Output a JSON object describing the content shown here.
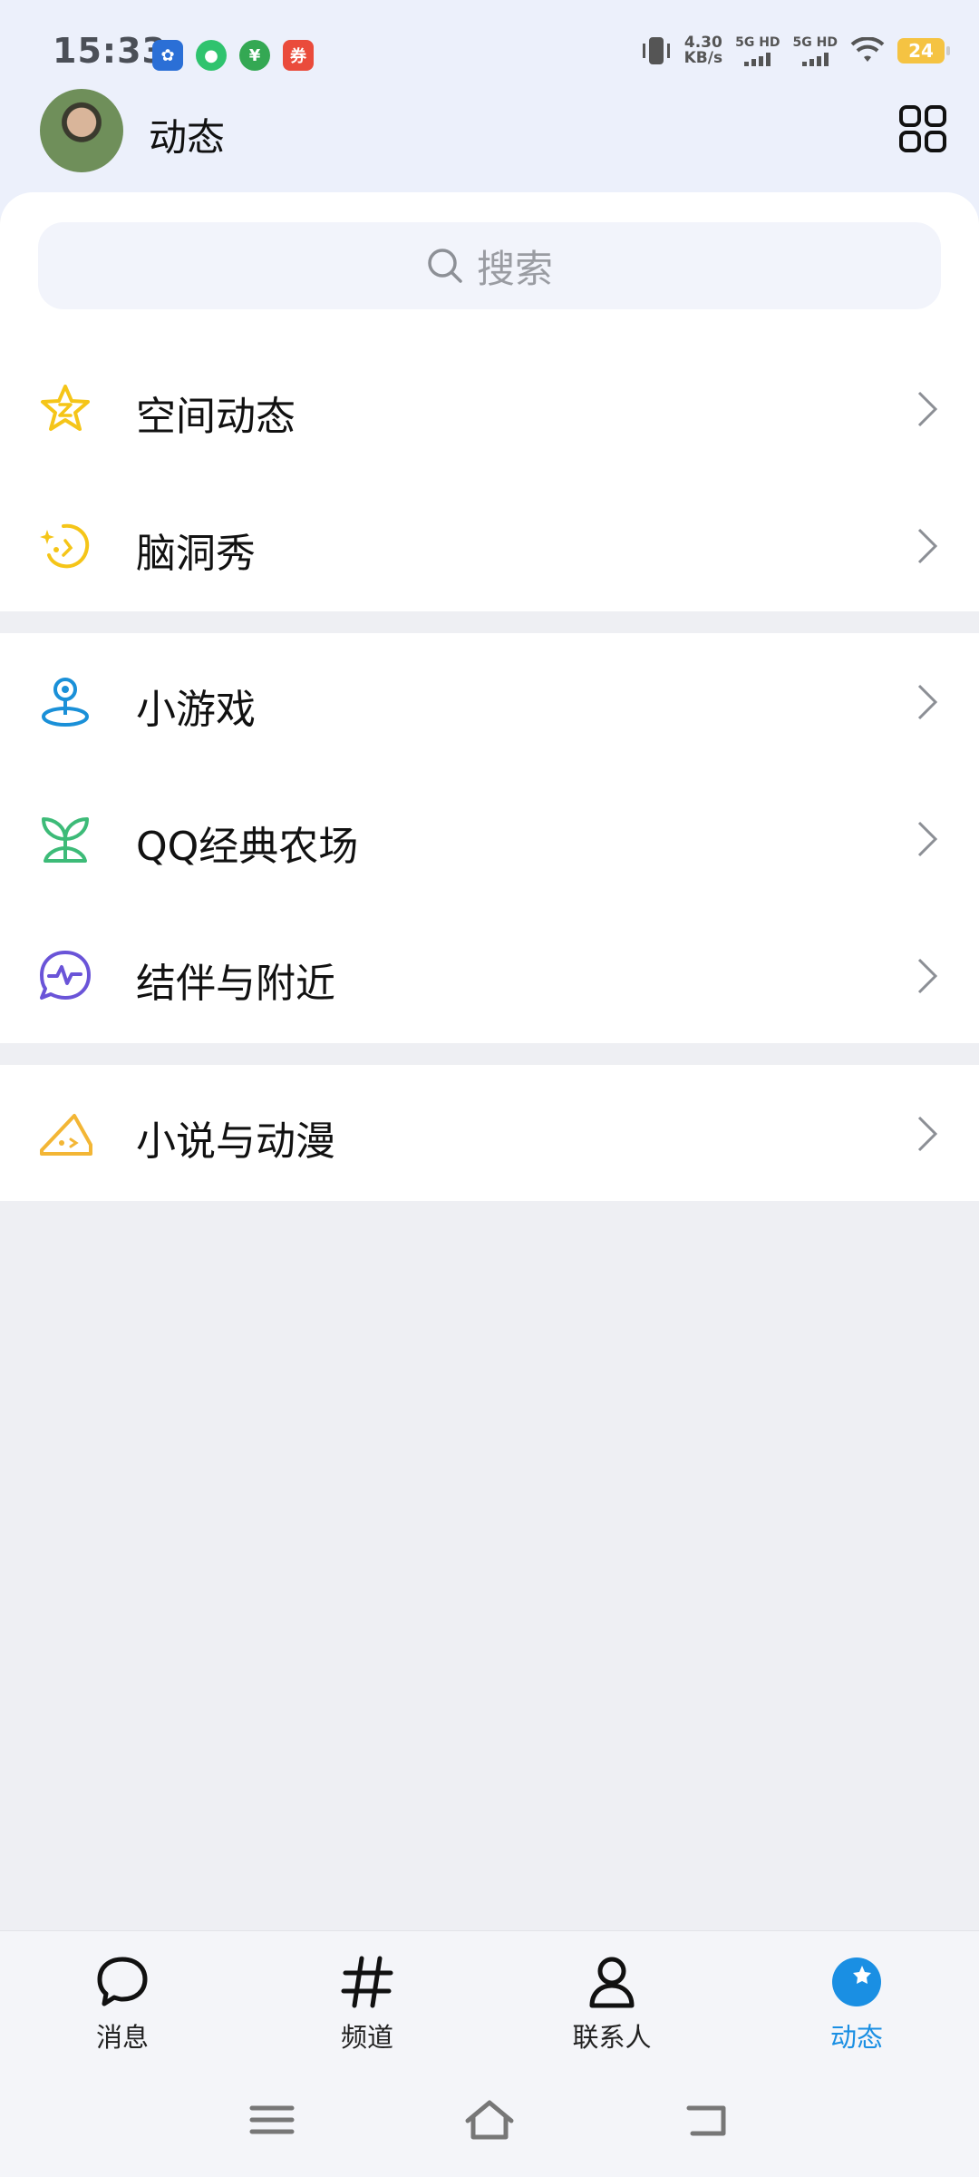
{
  "status_bar": {
    "time": "15:33",
    "speed_value": "4.30",
    "speed_unit": "KB/s",
    "sim1": "5G HD",
    "sim2": "5G HD",
    "battery": "24"
  },
  "header": {
    "title": "动态"
  },
  "search": {
    "placeholder": "搜索"
  },
  "section1": [
    {
      "label": "空间动态",
      "icon": "qzone-star-icon"
    },
    {
      "label": "脑洞秀",
      "icon": "brain-sparkle-icon"
    }
  ],
  "section2": [
    {
      "label": "小游戏",
      "icon": "game-pin-icon"
    },
    {
      "label": "QQ经典农场",
      "icon": "sprout-icon"
    },
    {
      "label": "结伴与附近",
      "icon": "pulse-bubble-icon"
    }
  ],
  "section3": [
    {
      "label": "小说与动漫",
      "icon": "cheese-book-icon"
    }
  ],
  "bottom_nav": {
    "tabs": [
      {
        "label": "消息",
        "icon": "chat-bubble-icon"
      },
      {
        "label": "频道",
        "icon": "hashtag-icon"
      },
      {
        "label": "联系人",
        "icon": "person-icon"
      },
      {
        "label": "动态",
        "icon": "star-circle-icon",
        "active": true
      }
    ]
  },
  "colors": {
    "accent": "#1a8fe3",
    "star_yellow": "#f5c518",
    "game_blue": "#1a90d8",
    "farm_green": "#3dbb78",
    "nearby_purple": "#6a54d8",
    "novel_yellow": "#f3b635"
  }
}
